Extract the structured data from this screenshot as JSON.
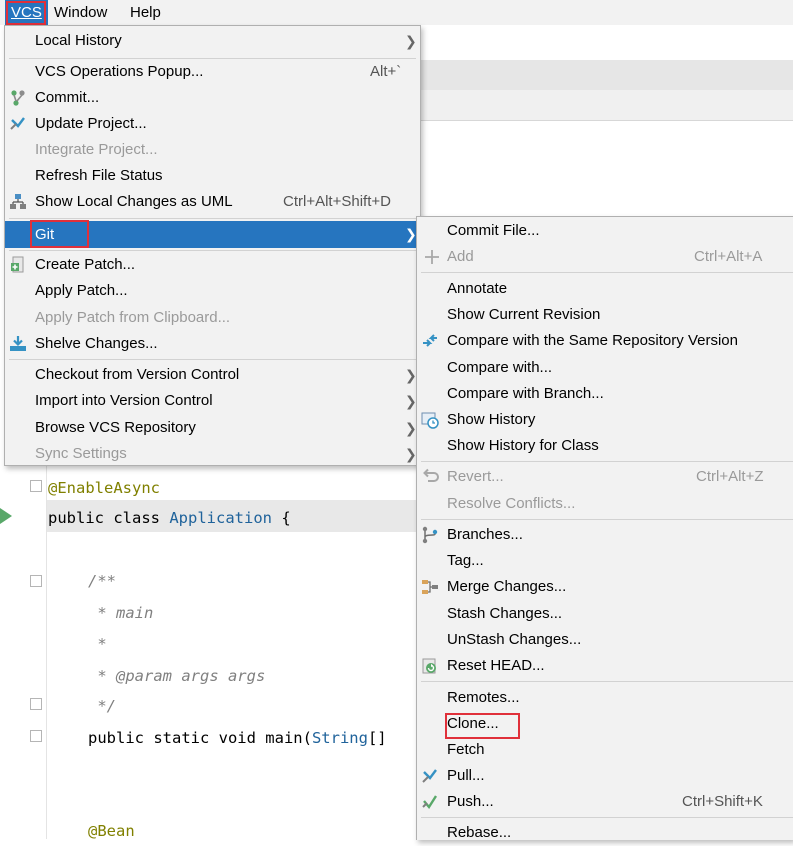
{
  "menubar": {
    "items": [
      "VCS",
      "Window",
      "Help"
    ]
  },
  "vcs_menu": {
    "local_history": "Local History",
    "ops_popup": "VCS Operations Popup...",
    "ops_popup_shortcut": "Alt+`",
    "commit": "Commit...",
    "update_project": "Update Project...",
    "integrate_project": "Integrate Project...",
    "refresh_status": "Refresh File Status",
    "show_uml": "Show Local Changes as UML",
    "show_uml_shortcut": "Ctrl+Alt+Shift+D",
    "git": "Git",
    "create_patch": "Create Patch...",
    "apply_patch": "Apply Patch...",
    "apply_patch_clipboard": "Apply Patch from Clipboard...",
    "shelve_changes": "Shelve Changes...",
    "checkout": "Checkout from Version Control",
    "import": "Import into Version Control",
    "browse": "Browse VCS Repository",
    "sync_settings": "Sync Settings"
  },
  "git_menu": {
    "commit_file": "Commit File...",
    "add": "Add",
    "add_shortcut": "Ctrl+Alt+A",
    "annotate": "Annotate",
    "show_current_revision": "Show Current Revision",
    "compare_same_repo": "Compare with the Same Repository Version",
    "compare_with": "Compare with...",
    "compare_branch": "Compare with Branch...",
    "show_history": "Show History",
    "show_history_class": "Show History for Class",
    "revert": "Revert...",
    "revert_shortcut": "Ctrl+Alt+Z",
    "resolve_conflicts": "Resolve Conflicts...",
    "branches": "Branches...",
    "tag": "Tag...",
    "merge_changes": "Merge Changes...",
    "stash_changes": "Stash Changes...",
    "unstash_changes": "UnStash Changes...",
    "reset_head": "Reset HEAD...",
    "remotes": "Remotes...",
    "clone": "Clone...",
    "fetch": "Fetch",
    "pull": "Pull...",
    "push": "Push...",
    "push_shortcut": "Ctrl+Shift+K",
    "rebase": "Rebase..."
  },
  "editor": {
    "line1": "@EnableAsync",
    "line2_kw": "public class ",
    "line2_cls": "Application",
    "line2_end": " {",
    "line3": "/**",
    "line4": " * main",
    "line5": " *",
    "line6": " * @param args args",
    "line7": " */",
    "line8_a": "public static void main(",
    "line8_cls": "String",
    "line8_b": "[]",
    "line9": "@Bean"
  },
  "colors": {
    "accent": "#2675bf",
    "highlight_box": "#e0303a",
    "menu_bg": "#f2f2f2"
  }
}
